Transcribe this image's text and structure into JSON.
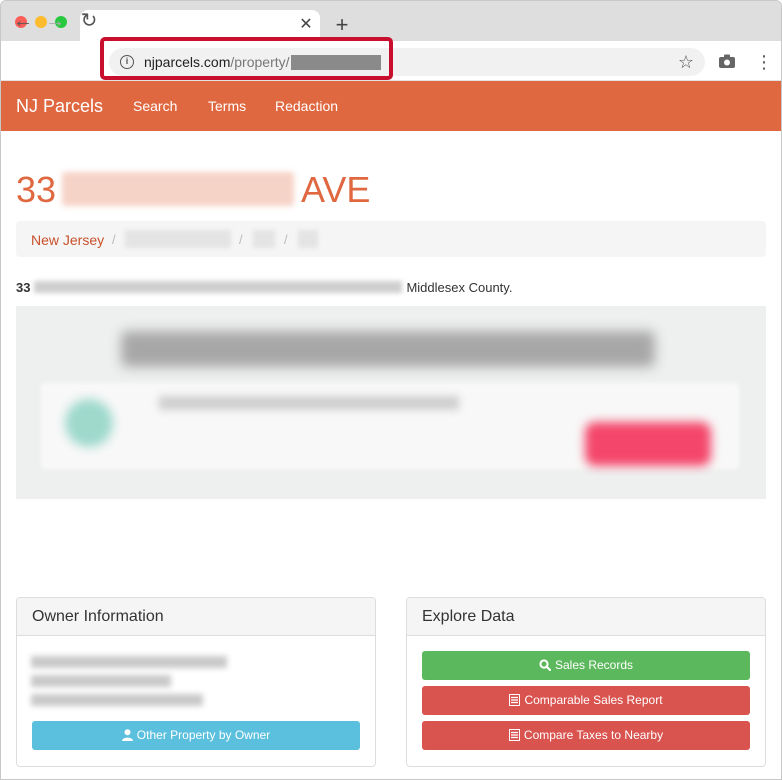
{
  "browser": {
    "url_host": "njparcels.com",
    "url_path": "/property/"
  },
  "navbar": {
    "brand": "NJ Parcels",
    "links": [
      "Search",
      "Terms",
      "Redaction"
    ]
  },
  "page": {
    "title_prefix": "33",
    "title_suffix": "AVE",
    "breadcrumb_first": "New Jersey",
    "breadcrumb_sep": "/",
    "description_number": "33",
    "description_tail": "Middlesex County."
  },
  "owner_panel": {
    "title": "Owner Information",
    "button_label": "Other Property by Owner"
  },
  "explore_panel": {
    "title": "Explore Data",
    "buttons": [
      "Sales Records",
      "Comparable Sales Report",
      "Compare Taxes to Nearby"
    ]
  },
  "colors": {
    "brand": "#e06841",
    "link": "#c9502b",
    "info": "#5bc0de",
    "success": "#5cb85c",
    "danger": "#d9534f",
    "highlight": "#c8102e"
  }
}
